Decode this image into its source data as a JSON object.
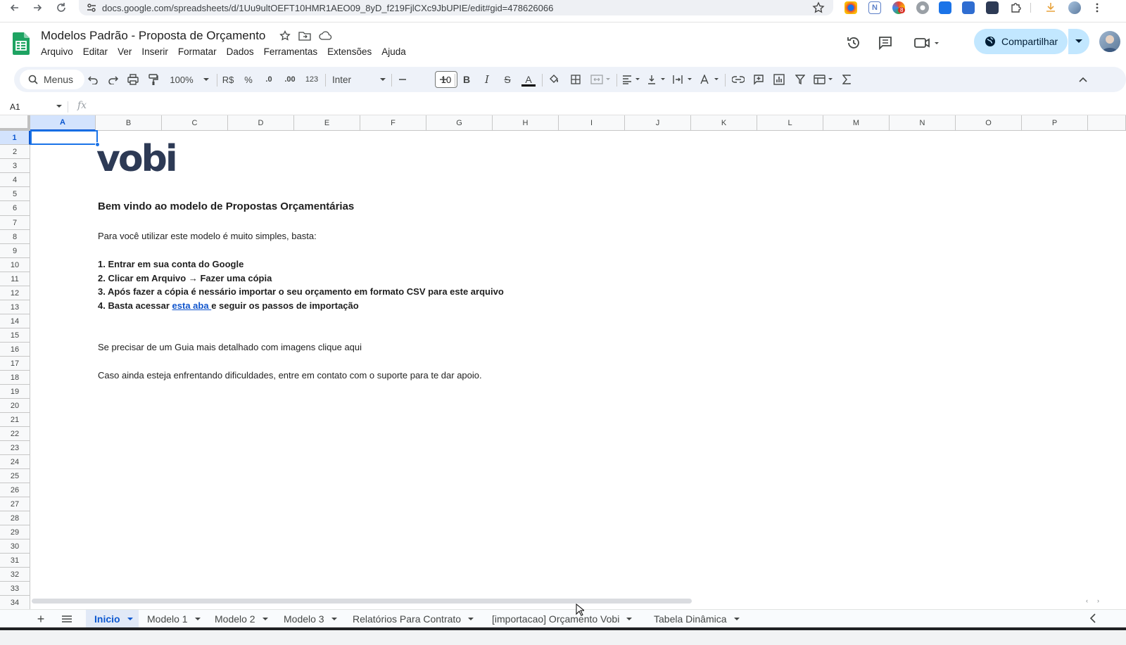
{
  "browser": {
    "url": "docs.google.com/spreadsheets/d/1Uu9ultOEFT10HMR1AEO09_8yD_f219FjlCXc9JbUPIE/edit#gid=478626066",
    "extension_badge": "8",
    "extensions": [
      "chrome-icon",
      "notion-icon",
      "puzzle-colorful-icon",
      "gear-extension-icon",
      "trello-icon",
      "s-extension-icon",
      "vobi-extension-icon",
      "extensions-puzzle-icon",
      "download-icon",
      "profile-icon"
    ]
  },
  "doc": {
    "title": "Modelos Padrão - Proposta de Orçamento",
    "menu": [
      "Arquivo",
      "Editar",
      "Ver",
      "Inserir",
      "Formatar",
      "Dados",
      "Ferramentas",
      "Extensões",
      "Ajuda"
    ],
    "share_label": "Compartilhar"
  },
  "toolbar": {
    "menus_label": "Menus",
    "zoom": "100%",
    "currency": "R$",
    "percent": "%",
    "dec_decrease": ".0",
    "dec_increase": ".00",
    "number_format": "123",
    "font": "Inter",
    "font_size": "10",
    "bold": "B",
    "italic": "I",
    "strike": "S",
    "text_color": "A"
  },
  "formula_bar": {
    "cell_ref": "A1",
    "fx": "fx",
    "value": ""
  },
  "grid": {
    "columns": [
      "A",
      "B",
      "C",
      "D",
      "E",
      "F",
      "G",
      "H",
      "I",
      "J",
      "K",
      "L",
      "M",
      "N",
      "O",
      "P"
    ],
    "rows": [
      "1",
      "2",
      "3",
      "4",
      "5",
      "6",
      "7",
      "8",
      "9",
      "10",
      "11",
      "12",
      "13",
      "14",
      "15",
      "16",
      "17",
      "18",
      "19",
      "20",
      "21",
      "22",
      "23",
      "24",
      "25",
      "26",
      "27",
      "28",
      "29",
      "30",
      "31",
      "32",
      "33",
      "34"
    ],
    "selected_cell": "A1"
  },
  "content": {
    "logo": "vobi",
    "heading": "Bem vindo ao modelo de Propostas Orçamentárias",
    "intro": "Para você utilizar este modelo é muito simples, basta:",
    "step1": "1. Entrar em sua conta do Google",
    "step2": "2. Clicar em Arquivo → Fazer uma cópia",
    "step3": "3. Após fazer a cópia é nessário importar o seu orçamento em formato CSV para este arquivo",
    "step4_prefix": "4. Basta acessar ",
    "step4_link": "esta aba ",
    "step4_suffix": "e seguir os passos de importação",
    "guide": "Se precisar de um Guia mais detalhado com imagens clique aqui",
    "support": "Caso ainda esteja enfrentando dificuldades, entre em contato com o suporte para te dar apoio."
  },
  "sheets": {
    "tabs": [
      "Inicio",
      "Modelo 1",
      "Modelo 2",
      "Modelo 3",
      "Relatórios Para Contrato",
      "[importacao] Orçamento Vobi",
      "Tabela Dinâmica"
    ],
    "active": "Inicio"
  },
  "colors": {
    "share_bg": "#c2e7ff",
    "selection": "#1a73e8",
    "active_tab": "#0b57d0",
    "logo": "#2d3a55",
    "link": "#1155cc"
  }
}
